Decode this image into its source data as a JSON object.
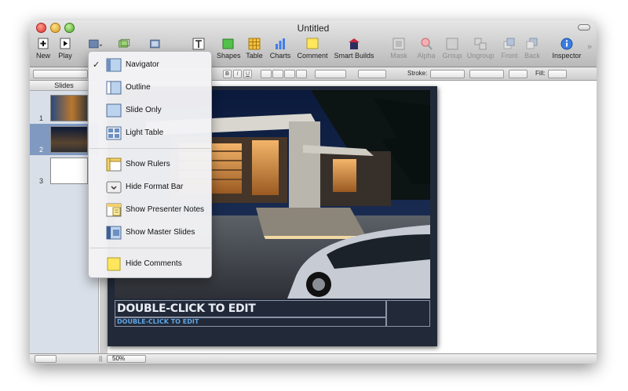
{
  "window": {
    "title": "Untitled"
  },
  "toolbar": {
    "new_label": "New",
    "play_label": "Play",
    "shapes_label": "Shapes",
    "table_label": "Table",
    "charts_label": "Charts",
    "comment_label": "Comment",
    "smart_builds_label": "Smart Builds",
    "mask_label": "Mask",
    "alpha_label": "Alpha",
    "group_label": "Group",
    "ungroup_label": "Ungroup",
    "front_label": "Front",
    "back_label": "Back",
    "inspector_label": "Inspector"
  },
  "formatbar": {
    "bold": "B",
    "italic": "I",
    "underline": "U",
    "stroke_label": "Stroke:",
    "fill_label": "Fill:"
  },
  "sidebar": {
    "header": "Slides",
    "slides": [
      {
        "number": "1"
      },
      {
        "number": "2"
      },
      {
        "number": "3"
      }
    ]
  },
  "view_menu": {
    "check": "✓",
    "items": [
      {
        "label": "Navigator"
      },
      {
        "label": "Outline"
      },
      {
        "label": "Slide Only"
      },
      {
        "label": "Light Table"
      },
      {
        "label": "Show Rulers"
      },
      {
        "label": "Hide Format Bar"
      },
      {
        "label": "Show Presenter Notes"
      },
      {
        "label": "Show Master Slides"
      },
      {
        "label": "Hide Comments"
      }
    ]
  },
  "slide": {
    "title": "DOUBLE-CLICK TO EDIT",
    "subtitle": "DOUBLE-CLICK TO EDIT"
  },
  "statusbar": {
    "zoom": "50%"
  },
  "colors": {
    "selection": "#7f99c1",
    "subtitle": "#5fa6e8",
    "slide_bg": "#222a39"
  }
}
